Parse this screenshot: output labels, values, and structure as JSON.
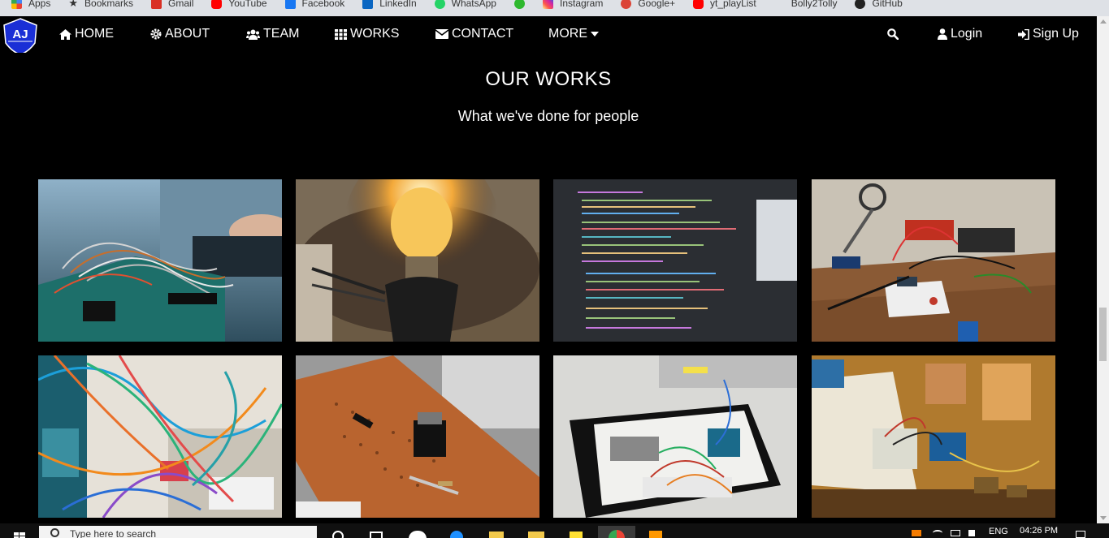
{
  "bookmarks": [
    {
      "label": "Apps",
      "icon": "apps-grid-icon",
      "color": "#4285f4"
    },
    {
      "label": "Bookmarks",
      "icon": "star-icon",
      "color": "#222222"
    },
    {
      "label": "Gmail",
      "icon": "gmail-icon",
      "color": "#d93025"
    },
    {
      "label": "YouTube",
      "icon": "youtube-icon",
      "color": "#ff0000"
    },
    {
      "label": "Facebook",
      "icon": "facebook-icon",
      "color": "#1877f2"
    },
    {
      "label": "LinkedIn",
      "icon": "linkedin-icon",
      "color": "#0a66c2"
    },
    {
      "label": "WhatsApp",
      "icon": "whatsapp-icon",
      "color": "#25d366"
    },
    {
      "label": "",
      "icon": "bolt-icon",
      "color": "#2eb82e"
    },
    {
      "label": "Instagram",
      "icon": "instagram-icon",
      "color": "#d6249f"
    },
    {
      "label": "Google+",
      "icon": "google-plus-icon",
      "color": "#db4437"
    },
    {
      "label": "yt_playList",
      "icon": "youtube-icon",
      "color": "#ff0000"
    },
    {
      "label": "Bolly2Tolly",
      "icon": "site-icon",
      "color": "#dee1e6"
    },
    {
      "label": "GitHub",
      "icon": "github-icon",
      "color": "#222222"
    }
  ],
  "navbar": {
    "logo_text": "AJ",
    "items": [
      {
        "label": "HOME",
        "icon": "home-icon"
      },
      {
        "label": "ABOUT",
        "icon": "gear-icon"
      },
      {
        "label": "TEAM",
        "icon": "users-icon"
      },
      {
        "label": "WORKS",
        "icon": "grid-icon"
      },
      {
        "label": "CONTACT",
        "icon": "envelope-icon"
      },
      {
        "label": "MORE",
        "icon": "caret-down-icon"
      }
    ],
    "right": [
      {
        "label": "",
        "icon": "search-icon"
      },
      {
        "label": "Login",
        "icon": "user-icon"
      },
      {
        "label": "Sign Up",
        "icon": "sign-in-icon"
      }
    ]
  },
  "section": {
    "title": "OUR WORKS",
    "subtitle": "What we've done for people"
  },
  "works": [
    {
      "name": "work-arduino-wires",
      "photo": "arduino board with jumper wires"
    },
    {
      "name": "work-light-bulb",
      "photo": "glowing light bulb"
    },
    {
      "name": "work-code-screen",
      "photo": "code on a screen"
    },
    {
      "name": "work-soldering-station",
      "photo": "soldering station and breadboard"
    },
    {
      "name": "work-colorful-wires",
      "photo": "colorful wires on breadboard"
    },
    {
      "name": "work-perfboard",
      "photo": "perfboard with components"
    },
    {
      "name": "work-enclosure",
      "photo": "electronics inside enclosure"
    },
    {
      "name": "work-workbench",
      "photo": "workbench with book and arduino"
    }
  ],
  "taskbar": {
    "search_placeholder": "Type here to search",
    "language": "ENG",
    "time": "04:26 PM"
  },
  "colors": {
    "page_background": "#000000",
    "navbar_background": "#000000",
    "text": "#ffffff",
    "bookmarks_bar": "#dee1e6",
    "taskbar": "#101010"
  }
}
